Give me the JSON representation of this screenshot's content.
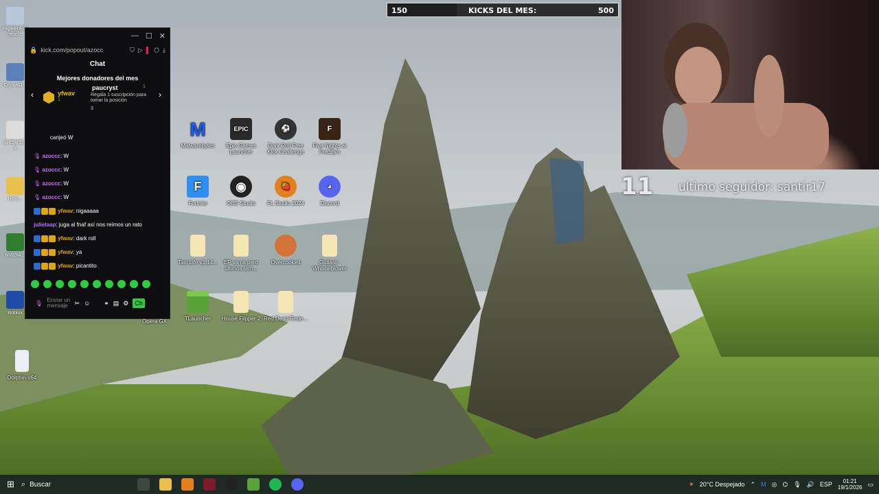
{
  "goal": {
    "current": "150",
    "title": "KICKS DEL MES:",
    "target": "500",
    "progress_fraction": 0.3
  },
  "follower": {
    "count": "11",
    "text": "ultimo seguidor: santir17"
  },
  "desktop_icons": [
    {
      "label": "Malwarebytes",
      "color": "#1a5cf2",
      "symbol": "M"
    },
    {
      "label": "Epic Games Launcher",
      "color": "#2a2a2a",
      "symbol": "EPIC"
    },
    {
      "label": "Dark Roll Free Kick Challenge",
      "color": "#333",
      "symbol": "⚽"
    },
    {
      "label": "Five Nights at Freddy's",
      "color": "#3a2415",
      "symbol": "F"
    },
    {
      "label": "Fortnite",
      "color": "#2d8ff0",
      "symbol": "F"
    },
    {
      "label": "OBS Studio",
      "color": "#222",
      "symbol": "◉"
    },
    {
      "label": "FL Studio 2024",
      "color": "#e37f1c",
      "symbol": "🍓"
    },
    {
      "label": "Discord",
      "color": "#5865f2",
      "symbol": "◕"
    },
    {
      "label": "Taxi Life v1.14...",
      "color": "#f4e6b3",
      "symbol": ""
    },
    {
      "label": "EP va ns pero ultimos tem...",
      "color": "#f4e6b3",
      "symbol": ""
    },
    {
      "label": "Overcooked",
      "color": "#d2733b",
      "symbol": ""
    },
    {
      "label": "Outlast - Whistleblower",
      "color": "#f4e6b3",
      "symbol": ""
    },
    {
      "label": "TLauncher",
      "color": "#5aa13a",
      "symbol": ""
    },
    {
      "label": "House Flipper 2",
      "color": "#f4e6b3",
      "symbol": ""
    },
    {
      "label": "Red.Dead.Rede...",
      "color": "#f4e6b3",
      "symbol": ""
    },
    {
      "label": "Opera GX",
      "color": "#1db954",
      "symbol": ""
    },
    {
      "label": "Dolphin-x64",
      "color": "#e9eef4",
      "symbol": ""
    }
  ],
  "left_icons": [
    {
      "label": "Papelera de recicl...",
      "color": "#b8c7d9"
    },
    {
      "label": "CrystalD...",
      "color": "#5b7fb7"
    },
    {
      "label": "SHOW D... X",
      "color": "#ddd"
    },
    {
      "label": "HOS...",
      "color": "#e9c14a"
    },
    {
      "label": "NVIDIA...",
      "color": "#2f7d2f"
    },
    {
      "label": "Roblox",
      "color": "#1f4aa6"
    }
  ],
  "chat": {
    "url": "kick.com/popout/azocc",
    "title": "Chat",
    "donors_title": "Mejores donadores del mes",
    "donor1": {
      "name": "yfwav",
      "count": "1"
    },
    "donor2": {
      "name": "paucryst",
      "count": "1",
      "text": "Regala 1 suscripción para tomar la posición",
      "position": "3"
    },
    "messages": [
      {
        "user": "",
        "text": "canjeó W",
        "color": "#b56bff"
      },
      {
        "user": "azoccc",
        "text": "W",
        "color": "#c86bff"
      },
      {
        "user": "azoccc",
        "text": "W",
        "color": "#c86bff"
      },
      {
        "user": "azoccc",
        "text": "W",
        "color": "#c86bff"
      },
      {
        "user": "azoccc",
        "text": "W",
        "color": "#c86bff"
      },
      {
        "user": "yfwav",
        "text": "nigaaaaa",
        "color": "#e0a800"
      },
      {
        "user": "julietaap",
        "text": "juga al fnaf así nos reímos un rato",
        "color": "#b56bff"
      },
      {
        "user": "yfwav",
        "text": "dark roll",
        "color": "#e0a800"
      },
      {
        "user": "yfwav",
        "text": "ya",
        "color": "#e0a800"
      },
      {
        "user": "yfwav",
        "text": "picantito",
        "color": "#e0a800"
      }
    ],
    "input_placeholder": "Enviar un mensaje",
    "send_label": "Ch"
  },
  "taskbar": {
    "search_label": "Buscar",
    "weather": "20°C Despejado",
    "lang": "ESP",
    "time": "01:21",
    "date": "19/1/2026"
  }
}
